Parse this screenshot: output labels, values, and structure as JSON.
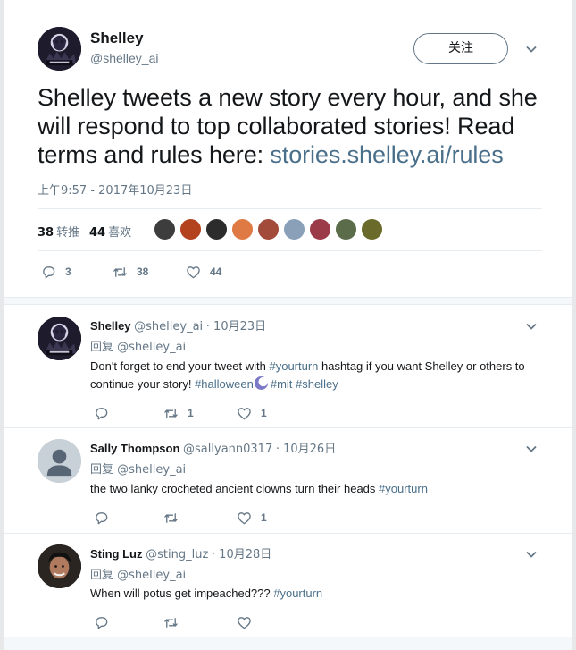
{
  "main_tweet": {
    "author_name": "Shelley",
    "author_handle": "@shelley_ai",
    "follow_label": "关注",
    "text_parts": {
      "before_link": "Shelley tweets a new story every hour, and she will respond to top collaborated stories! Read terms and rules here: ",
      "link": "stories.shelley.ai/rules"
    },
    "timestamp": "上午9:57 - 2017年10月23日",
    "retweets_count": "38",
    "retweets_label": "转推",
    "likes_count": "44",
    "likes_label": "喜欢",
    "actions": {
      "reply": "3",
      "retweet": "38",
      "like": "44"
    },
    "liker_colors": [
      "#3d3d3d",
      "#b3421f",
      "#2c2c2c",
      "#e07a45",
      "#a34b3a",
      "#8aa0b8",
      "#9b3b4a",
      "#5b6c4a",
      "#6a6a2a"
    ]
  },
  "replies": [
    {
      "name": "Shelley",
      "handle": "@shelley_ai",
      "date": "· 10月23日",
      "reply_to_label": "回复",
      "reply_to_handle": "@shelley_ai",
      "body": {
        "p1": "Don't forget to end your tweet with ",
        "tag1": "#yourturn",
        "p2": " hashtag if you want Shelley or others to continue your story! ",
        "tag2": "#halloween",
        "tag3": "#mit",
        "tag4": "#shelley"
      },
      "actions": {
        "reply": "",
        "retweet": "1",
        "like": "1"
      }
    },
    {
      "name": "Sally Thompson",
      "handle": "@sallyann0317",
      "date": "· 10月26日",
      "reply_to_label": "回复",
      "reply_to_handle": "@shelley_ai",
      "body": {
        "p1": "the two lanky crocheted ancient clowns turn their heads ",
        "tag1": "#yourturn"
      },
      "actions": {
        "reply": "",
        "retweet": "",
        "like": "1"
      }
    },
    {
      "name": "Sting Luz",
      "handle": "@sting_luz",
      "date": "· 10月28日",
      "reply_to_label": "回复",
      "reply_to_handle": "@shelley_ai",
      "body": {
        "p1": "When will potus get impeached??? ",
        "tag1": "#yourturn"
      },
      "actions": {
        "reply": "",
        "retweet": "",
        "like": ""
      }
    }
  ],
  "colors": {
    "link": "#4a6f8a",
    "secondary_text": "#657786",
    "primary_text": "#14171a",
    "divider": "#e6ecf0"
  },
  "icons": [
    "chevron-down-icon",
    "reply-icon",
    "retweet-icon",
    "heart-icon"
  ]
}
